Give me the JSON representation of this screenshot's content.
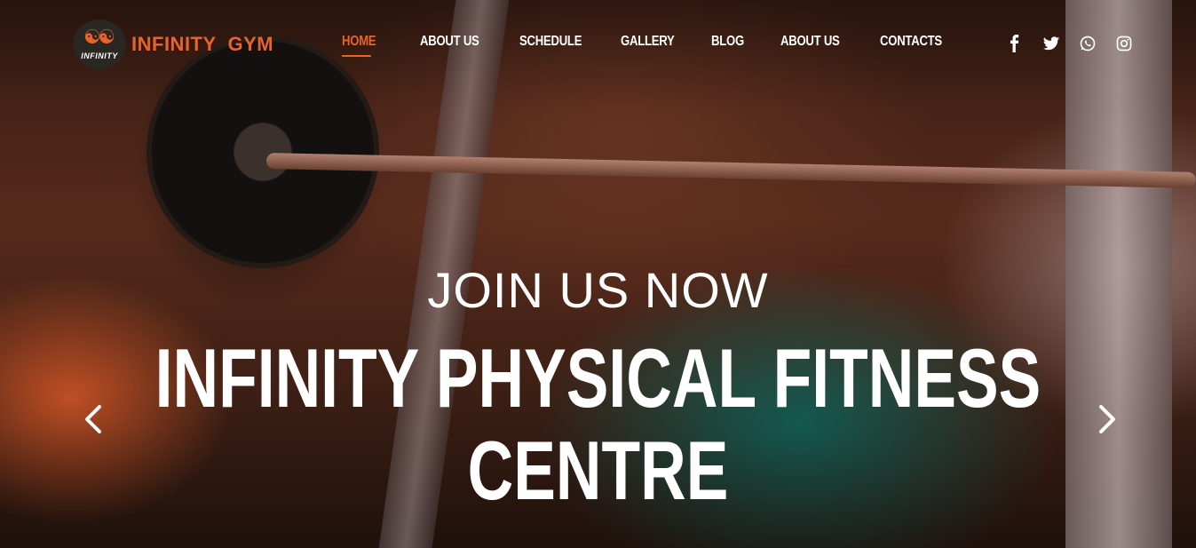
{
  "brand": {
    "logo_text": "INFINITY",
    "name": "INFINITY  GYM",
    "accent_color": "#e8632a"
  },
  "nav": {
    "items": [
      {
        "label": "HOME",
        "active": true
      },
      {
        "label": "ABOUT US",
        "active": false
      },
      {
        "label": "SCHEDULE",
        "active": false
      },
      {
        "label": "GALLERY",
        "active": false
      },
      {
        "label": "BLOG",
        "active": false
      },
      {
        "label": "ABOUT US",
        "active": false
      },
      {
        "label": "CONTACTS",
        "active": false
      }
    ]
  },
  "social": {
    "icons": [
      "facebook-icon",
      "twitter-icon",
      "whatsapp-icon",
      "instagram-icon"
    ]
  },
  "hero": {
    "subtitle": "JOIN US NOW",
    "title_line1": "INFINITY PHYSICAL FITNESS",
    "title_line2": "CENTRE",
    "prev_icon": "chevron-left-icon",
    "next_icon": "chevron-right-icon"
  }
}
